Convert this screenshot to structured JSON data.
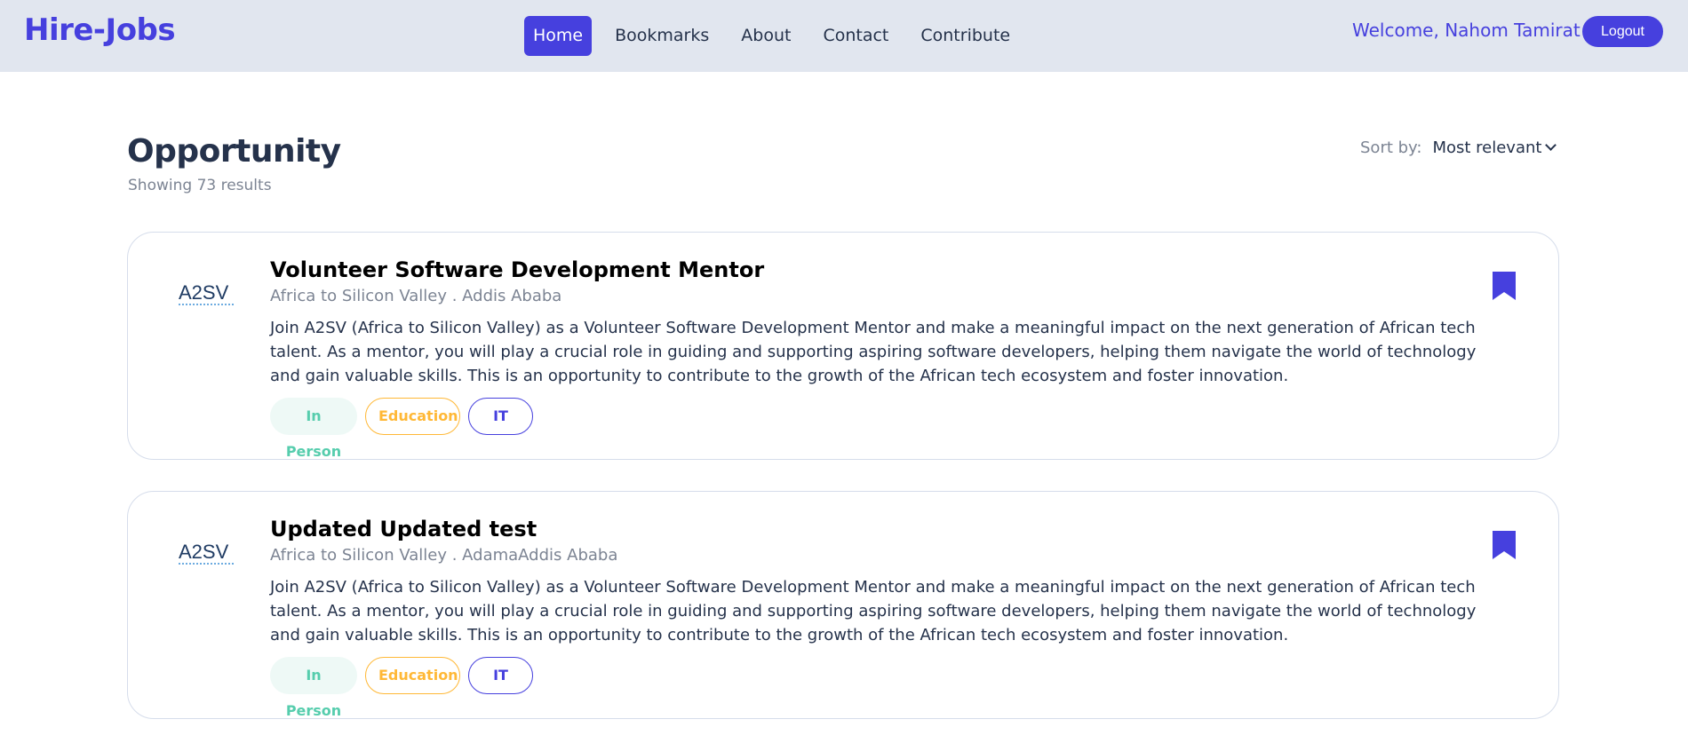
{
  "nav": {
    "brand": "Hire-Jobs",
    "links": [
      "Home",
      "Bookmarks",
      "About",
      "Contact",
      "Contribute"
    ],
    "active": "Home",
    "welcome": "Welcome, Nahom Tamirat",
    "logout": "Logout"
  },
  "header": {
    "title": "Opportunity",
    "result_count": "Showing 73 results",
    "sort_label": "Sort by:",
    "sort_value": "Most relevant"
  },
  "jobs": [
    {
      "title": "Volunteer Software Development Mentor",
      "meta": "Africa to Silicon Valley . Addis Ababa",
      "logo_text": "A2SV",
      "description": "Join A2SV (Africa to Silicon Valley) as a Volunteer Software Development Mentor and make a meaningful impact on the next generation of African tech talent. As a mentor, you will play a crucial role in guiding and supporting aspiring software developers, helping them navigate the world of technology and gain valuable skills. This is an opportunity to contribute to the growth of the African tech ecosystem and foster innovation.",
      "tags": [
        "In Person",
        "Education",
        "IT"
      ],
      "bookmarked": true
    },
    {
      "title": "Updated Updated test",
      "meta": "Africa to Silicon Valley . AdamaAddis Ababa",
      "logo_text": "A2SV",
      "description": "Join A2SV (Africa to Silicon Valley) as a Volunteer Software Development Mentor and make a meaningful impact on the next generation of African tech talent. As a mentor, you will play a crucial role in guiding and supporting aspiring software developers, helping them navigate the world of technology and gain valuable skills. This is an opportunity to contribute to the growth of the African tech ecosystem and foster innovation.",
      "tags": [
        "In Person",
        "Education",
        "IT"
      ],
      "bookmarked": true
    }
  ],
  "colors": {
    "primary": "#4640DE",
    "navbar_bg": "#E1E6EF",
    "tag_green": "#56CDAD",
    "tag_orange": "#FFB836"
  }
}
